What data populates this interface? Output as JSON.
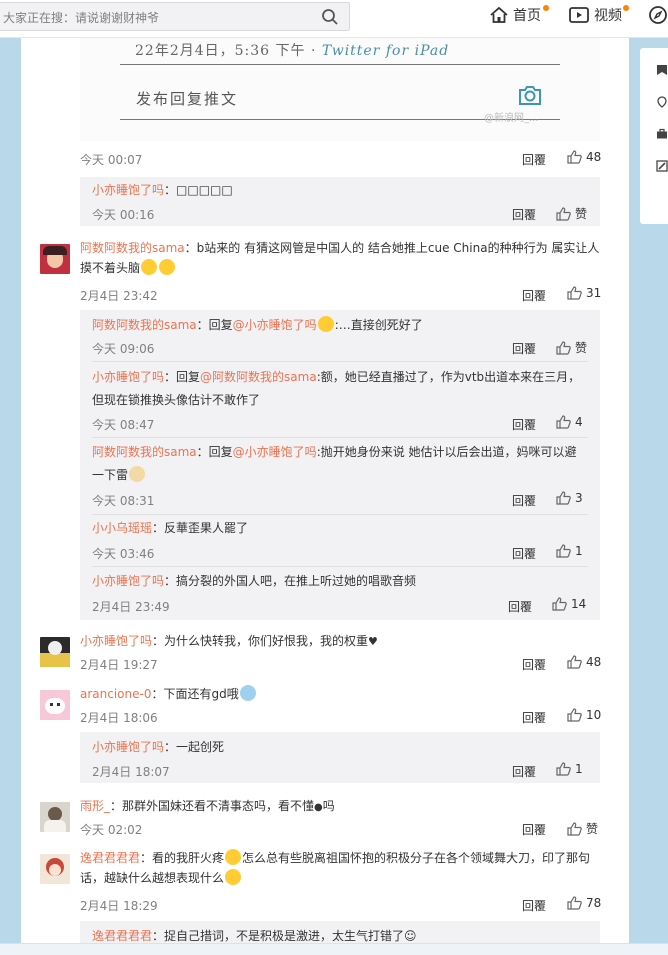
{
  "topbar": {
    "search_placeholder": "大家正在搜：请说谢谢财神爷",
    "nav": [
      {
        "label": "首页",
        "icon": "home-icon"
      },
      {
        "label": "视频",
        "icon": "video-icon"
      }
    ]
  },
  "image": {
    "timestamp_line": "22年2月4日，5:36 下午 · ",
    "source": "Twitter for iPad",
    "reply_prompt": "发布回复推文",
    "watermark": "@新浪网_..."
  },
  "labels": {
    "reply": "回覆",
    "like_word": "赞"
  },
  "post": {
    "time": "今天 00:07",
    "likes": "48"
  },
  "thread1": [
    {
      "user": "小亦睡饱了吗",
      "sep": "：",
      "text": "□□□□□",
      "time": "今天 00:16",
      "likes": "赞"
    }
  ],
  "comment2": {
    "user": "阿数阿数我的sama",
    "text": "：b站来的 有猜这网管是中国人的 结合她推上cue China的种种行为 属实让人摸不着头脑",
    "time": "2月4日 23:42",
    "likes": "31"
  },
  "thread2": [
    {
      "user": "阿数阿数我的sama",
      "sep": "：回复",
      "at": "@小亦睡饱了吗",
      "text": ":…直接创死好了",
      "time": "今天 09:06",
      "likes": "赞"
    },
    {
      "user": "小亦睡饱了吗",
      "sep": "：回复",
      "at": "@阿数阿数我的sama",
      "text": ":额，她已经直播过了，作为vtb出道本来在三月，但现在锁推换头像估计不敢作了",
      "time": "今天 08:47",
      "likes": "4"
    },
    {
      "user": "阿数阿数我的sama",
      "sep": "：回复",
      "at": "@小亦睡饱了吗",
      "text": ":抛开她身份来说 她估计以后会出道，妈咪可以避一下雷",
      "time": "今天 08:31",
      "likes": "3"
    },
    {
      "user": "小小乌瑶瑶",
      "sep": "：",
      "text": "反華歪果人罷了",
      "time": "今天 03:46",
      "likes": "1"
    },
    {
      "user": "小亦睡饱了吗",
      "sep": "：",
      "text": "搞分裂的外国人吧，在推上听过她的唱歌音频",
      "time": "2月4日 23:49",
      "likes": "14"
    }
  ],
  "comment3": {
    "user": "小亦睡饱了吗",
    "text": "：为什么快转我，你们好恨我，我的权重",
    "time": "2月4日 19:27",
    "likes": "48"
  },
  "comment4": {
    "user": "arancione-0",
    "text": "：下面还有gd哦",
    "time": "2月4日 18:06",
    "likes": "10"
  },
  "thread4": [
    {
      "user": "小亦睡饱了吗",
      "sep": "：",
      "text": "一起创死",
      "time": "2月4日 18:07",
      "likes": "1"
    }
  ],
  "comment5": {
    "user": "雨形_",
    "text": "：那群外国妹还看不清事态吗，看不懂",
    "text_end": "吗",
    "time": "今天 02:02",
    "likes": "赞"
  },
  "comment6": {
    "user": "逸君君君君",
    "text": "：看的我肝火疼",
    "text2": "怎么总有些脱离祖国怀抱的积极分子在各个领域舞大刀，印了那句话，越缺什么越想表现什么",
    "time": "2月4日 18:29",
    "likes": "78"
  },
  "thread6": [
    {
      "user": "逸君君君君",
      "sep": "：",
      "text": "捉自己措词，不是积极是激进，太生气打错了"
    }
  ]
}
